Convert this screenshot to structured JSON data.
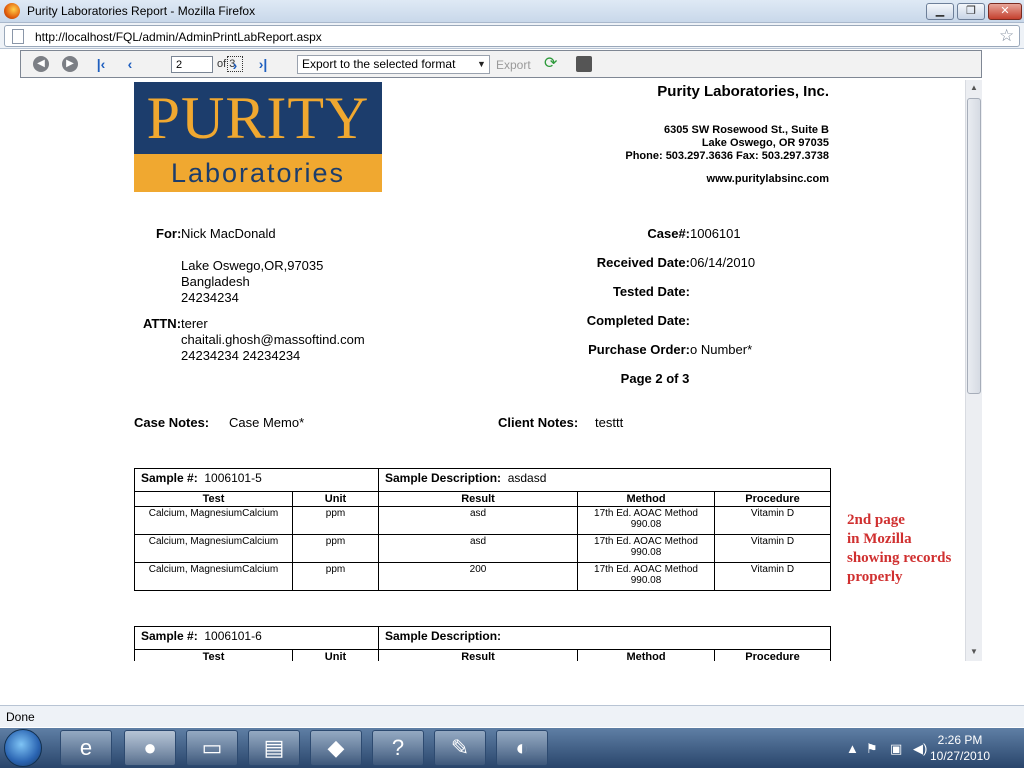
{
  "window": {
    "title": "Purity Laboratories Report - Mozilla Firefox"
  },
  "address": {
    "url": "http://localhost/FQL/admin/AdminPrintLabReport.aspx"
  },
  "toolbar": {
    "page_value": "2",
    "of_label": "of 3",
    "export_select": "Export to the selected format",
    "export_label": "Export"
  },
  "company": {
    "logo_top": "PURITY",
    "logo_bottom": "Laboratories",
    "name": "Purity Laboratories, Inc.",
    "address1": "6305 SW Rosewood St., Suite B",
    "address2": "Lake Oswego, OR 97035",
    "phone": "Phone: 503.297.3636 Fax: 503.297.3738",
    "website": "www.puritylabsinc.com"
  },
  "client": {
    "for_label": "For:",
    "name": "Nick MacDonald",
    "address_lines": [
      "Lake Oswego,OR,97035",
      "Bangladesh",
      "24234234"
    ],
    "attn_label": "ATTN:",
    "attn": "terer",
    "attn_lines": [
      "chaitali.ghosh@massoftind.com",
      "24234234 24234234"
    ]
  },
  "case": {
    "case_label": "Case#:",
    "case_no": "1006101",
    "received_label": "Received Date:",
    "received": "06/14/2010",
    "tested_label": "Tested Date:",
    "completed_label": "Completed Date:",
    "po_label": "Purchase Order:",
    "po": "o Number*",
    "page_label": "Page 2 of 3"
  },
  "notes": {
    "case_label": "Case Notes:",
    "case_value": "Case Memo*",
    "client_label": "Client Notes:",
    "client_value": "testtt"
  },
  "columns": [
    "Test",
    "Unit",
    "Result",
    "Method",
    "Procedure"
  ],
  "samples": [
    {
      "label": "Sample #:",
      "number": "1006101-5",
      "desc_label": "Sample Description:",
      "desc": "asdasd",
      "rows": [
        {
          "test": "Calcium, MagnesiumCalcium",
          "unit": "ppm",
          "result": "asd",
          "method1": "17th Ed. AOAC Method",
          "method2": "990.08",
          "procedure": "Vitamin D"
        },
        {
          "test": "Calcium, MagnesiumCalcium",
          "unit": "ppm",
          "result": "asd",
          "method1": "17th Ed. AOAC Method",
          "method2": "990.08",
          "procedure": "Vitamin D"
        },
        {
          "test": "Calcium, MagnesiumCalcium",
          "unit": "ppm",
          "result": "200",
          "method1": "17th Ed. AOAC Method",
          "method2": "990.08",
          "procedure": "Vitamin D"
        }
      ]
    },
    {
      "label": "Sample #:",
      "number": "1006101-6",
      "desc_label": "Sample Description:",
      "desc": ""
    }
  ],
  "annotation": [
    "2nd page",
    "in Mozilla",
    "showing records",
    "properly"
  ],
  "status": {
    "text": "Done"
  },
  "taskbar": {
    "time": "2:26 PM",
    "date": "10/27/2010"
  }
}
